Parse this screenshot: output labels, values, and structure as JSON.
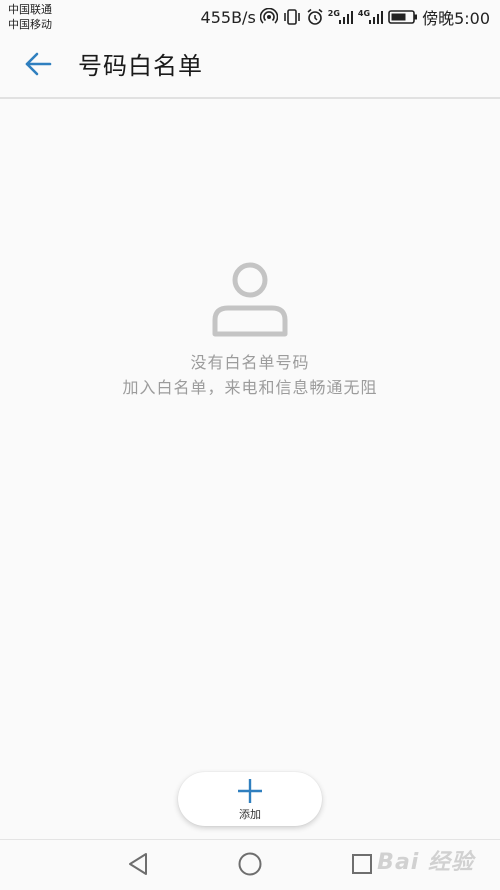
{
  "status_bar": {
    "carrier_1": "中国联通",
    "carrier_2": "中国移动",
    "net_speed": "455B/s",
    "signal_tag_1": "2G",
    "signal_tag_2": "4G",
    "time": "傍晚5:00"
  },
  "app_bar": {
    "title": "号码白名单",
    "back_icon": "arrow-left-icon"
  },
  "empty_state": {
    "icon": "person-outline-icon",
    "title": "没有白名单号码",
    "subtitle": "加入白名单，来电和信息畅通无阻"
  },
  "add_button": {
    "icon": "plus-icon",
    "label": "添加"
  },
  "nav_bar": {
    "back_icon": "triangle-back-icon",
    "home_icon": "circle-home-icon",
    "recents_icon": "square-recents-icon"
  },
  "watermark": {
    "text": "Bai 经验"
  },
  "colors": {
    "accent": "#2f7fbf",
    "background": "#fafafa",
    "hint_text": "#9c9c9c",
    "icon_gray": "#c4c4c4"
  }
}
